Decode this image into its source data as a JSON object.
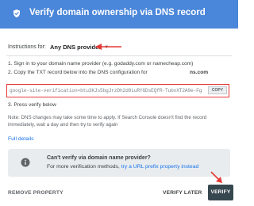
{
  "header": {
    "title": "Verify domain ownership via DNS record"
  },
  "instructions": {
    "label": "Instructions for:",
    "selected_provider": "Any DNS provider"
  },
  "steps": {
    "step1": "1. Sign in to your domain name provider (e.g. godaddy.com or namecheap.com)",
    "step2": "2. Copy the TXT record below into the DNS configuration for",
    "domain_suffix": "ns.com",
    "step3": "3. Press verify below"
  },
  "txt_record": {
    "value": "google-site-verification=btu3KJs5bgJrzDh2d0LuRYGDsEQfR-TubvXT2A9e-Fg",
    "copy_label": "COPY"
  },
  "note": {
    "text": "Note: DNS changes may take some time to apply. If Search Console doesn't find the record immediately, wait a day and then try to verify again"
  },
  "full_details": {
    "label": "Full details"
  },
  "info_card": {
    "title": "Can't verify via domain name provider?",
    "text_prefix": "For more verification methods, ",
    "link_text": "try a URL prefix property instead"
  },
  "footer": {
    "remove_label": "REMOVE PROPERTY",
    "verify_later_label": "VERIFY LATER",
    "verify_label": "VERIFY"
  },
  "colors": {
    "header_bg": "#4a86d9",
    "accent_link": "#1a73e8",
    "highlight_red": "#e53935",
    "verify_button_bg": "#37474f"
  },
  "icons": {
    "header": "shield-check-icon",
    "info": "info-icon",
    "dropdown": "chevron-down-icon",
    "annotation": "red-arrow-icon"
  }
}
